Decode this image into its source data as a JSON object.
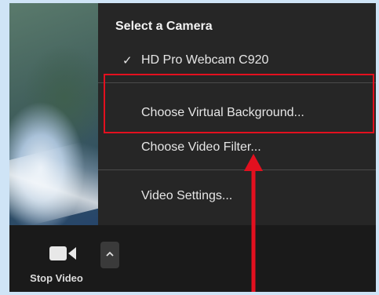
{
  "menu": {
    "header": "Select a Camera",
    "items": [
      {
        "label": "HD Pro Webcam C920",
        "checked": true
      },
      {
        "label": "Choose Virtual Background...",
        "checked": false
      },
      {
        "label": "Choose Video Filter...",
        "checked": false
      },
      {
        "label": "Video Settings...",
        "checked": false
      }
    ],
    "check_glyph": "✓"
  },
  "toolbar": {
    "stop_video_label": "Stop Video",
    "stop_video_icon": "video-camera-icon",
    "options_icon": "chevron-up-icon"
  },
  "annotations": {
    "highlight_color": "#e3101f",
    "arrow_color": "#e3101f"
  }
}
